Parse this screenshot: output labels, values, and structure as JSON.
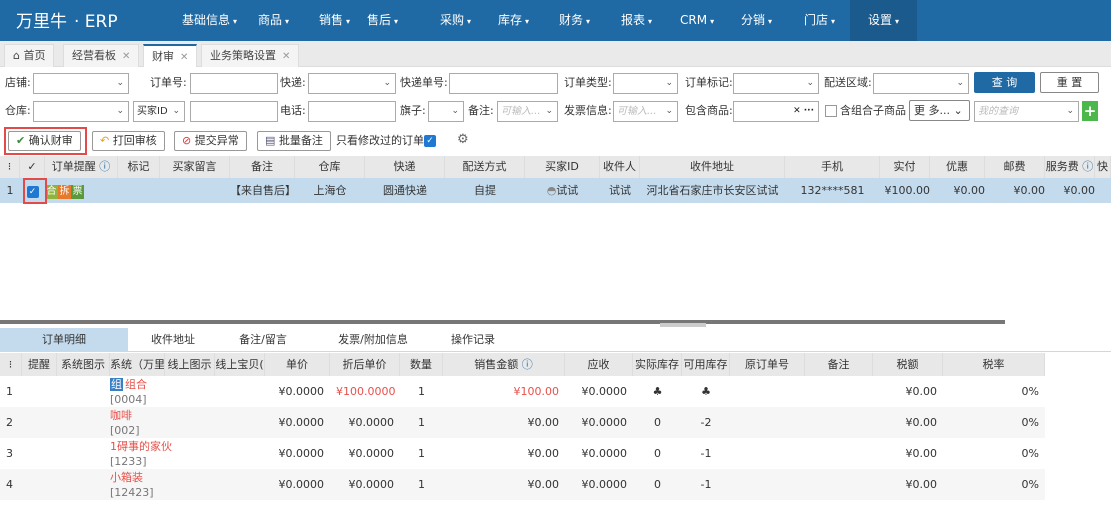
{
  "app": {
    "logo": "万里牛",
    "suffix": "· ERP"
  },
  "nav": [
    "基础信息",
    "商品",
    "销售",
    "售后",
    "采购",
    "库存",
    "财务",
    "报表",
    "CRM",
    "分销",
    "门店",
    "设置"
  ],
  "tabs": [
    {
      "label": "首页"
    },
    {
      "label": "经营看板"
    },
    {
      "label": "财审"
    },
    {
      "label": "业务策略设置"
    }
  ],
  "filters": {
    "shop": "店铺:",
    "order_no": "订单号:",
    "express": "快递:",
    "express_no": "快递单号:",
    "order_type": "订单类型:",
    "order_mark": "订单标记:",
    "region": "配送区域:",
    "warehouse": "仓库:",
    "buyer_id_select": "买家ID",
    "phone": "电话:",
    "flag": "旗子:",
    "remark": "备注:",
    "remark_placeholder": "可输入...",
    "invoice": "发票信息:",
    "invoice_placeholder": "可输入...",
    "contains": "包含商品:",
    "combo": "含组合子商品",
    "more": "更 多...",
    "my_query_placeholder": "我的查询",
    "query": "查 询",
    "reset": "重 置"
  },
  "toolbar": {
    "confirm": "确认财审",
    "reject": "打回审核",
    "exception": "提交异常",
    "batch_remark": "批量备注",
    "only_modified": "只看修改过的订单"
  },
  "order_grid": {
    "headers": [
      "⁝",
      "✓",
      "订单提醒",
      "标记",
      "买家留言",
      "备注",
      "仓库",
      "快递",
      "配送方式",
      "买家ID",
      "收件人",
      "收件地址",
      "手机",
      "实付",
      "优惠",
      "邮费",
      "服务费",
      "快"
    ],
    "rows": [
      {
        "index": "1",
        "badges": [
          "合",
          "拆",
          "票"
        ],
        "remark": "【来自售后】",
        "warehouse": "上海仓",
        "express": "圆通快递",
        "delivery": "自提",
        "buyer_id": "试试",
        "receiver": "试试",
        "address": "河北省石家庄市长安区试试",
        "mobile": "132****581",
        "paid": "¥100.00",
        "discount": "¥0.00",
        "postage": "¥0.00",
        "service": "¥0.00"
      }
    ]
  },
  "detail_tabs": [
    "订单明细",
    "收件地址",
    "备注/留言",
    "发票/附加信息",
    "操作记录"
  ],
  "detail_grid": {
    "headers": [
      "⁝",
      "提醒",
      "系统图示",
      "系统（万里牛",
      "线上图示",
      "线上宝贝(",
      "单价",
      "折后单价",
      "数量",
      "销售金额",
      "应收",
      "实际库存",
      "可用库存",
      "原订单号",
      "备注",
      "税额",
      "税率"
    ],
    "rows": [
      {
        "index": "1",
        "tag": "组",
        "name": "组合",
        "code": "[0004]",
        "price": "¥0.0000",
        "disc_price": "¥100.0000",
        "qty": "1",
        "amount": "¥100.00",
        "receivable": "¥0.0000",
        "actual_stock": "",
        "avail_stock": "",
        "tax": "¥0.00",
        "rate": "0%"
      },
      {
        "index": "2",
        "tag": "",
        "name": "咖啡",
        "code": "[002]",
        "price": "¥0.0000",
        "disc_price": "¥0.0000",
        "qty": "1",
        "amount": "¥0.00",
        "receivable": "¥0.0000",
        "actual_stock": "0",
        "avail_stock": "-2",
        "tax": "¥0.00",
        "rate": "0%"
      },
      {
        "index": "3",
        "tag": "",
        "name": "1碍事的家伙",
        "code": "[1233]",
        "price": "¥0.0000",
        "disc_price": "¥0.0000",
        "qty": "1",
        "amount": "¥0.00",
        "receivable": "¥0.0000",
        "actual_stock": "0",
        "avail_stock": "-1",
        "tax": "¥0.00",
        "rate": "0%"
      },
      {
        "index": "4",
        "tag": "",
        "name": "小箱装",
        "code": "[12423]",
        "price": "¥0.0000",
        "disc_price": "¥0.0000",
        "qty": "1",
        "amount": "¥0.00",
        "receivable": "¥0.0000",
        "actual_stock": "0",
        "avail_stock": "-1",
        "tax": "¥0.00",
        "rate": "0%"
      }
    ]
  },
  "colors": {
    "nav": "#1f69a4",
    "selected_row": "#c4dbee",
    "red": "#e8504a",
    "highlight_box": "#e34a4a",
    "add_green": "#4cb84c"
  }
}
